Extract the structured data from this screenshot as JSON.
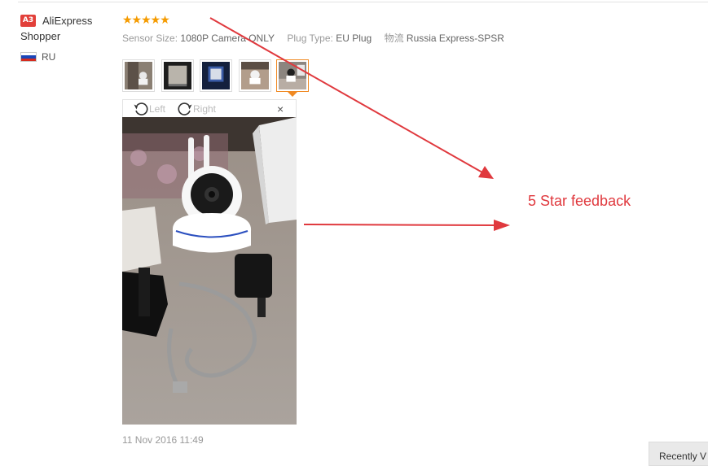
{
  "reviewer": {
    "badge": "A3",
    "name": "AliExpress Shopper",
    "country": "RU",
    "flag_icon": "russia-flag-icon",
    "flag_colors": [
      "#ffffff",
      "#1a46b8",
      "#d52b1e"
    ]
  },
  "review": {
    "rating": 5,
    "stars": "★★★★★",
    "star_color": "#f59b00",
    "attributes": [
      {
        "key": "Sensor Size:",
        "value": "1080P Camera ONLY"
      },
      {
        "key": "Plug Type:",
        "value": "EU Plug"
      },
      {
        "key": "物流",
        "value": "Russia Express-SPSR"
      }
    ],
    "thumbnails_count": 5,
    "selected_thumbnail": 5,
    "viewer": {
      "rotate_left": "Left",
      "rotate_right": "Right",
      "close": "×"
    },
    "date": "11 Nov 2016 11:49"
  },
  "annotation": {
    "text": "5 Star feedback",
    "color": "#e0393e"
  },
  "recently_viewed_label": "Recently V"
}
